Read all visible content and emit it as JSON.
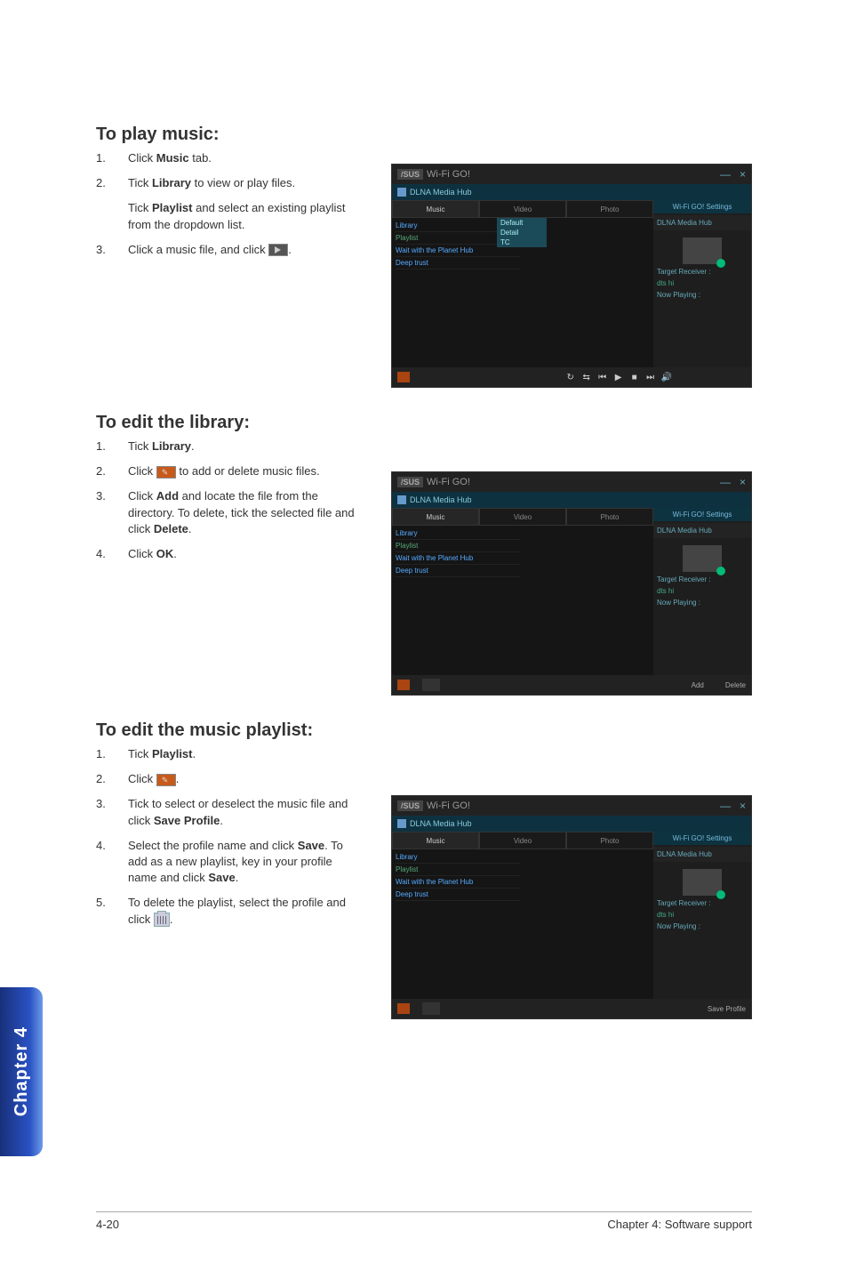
{
  "sections": {
    "playMusic": {
      "heading": "To play music:",
      "steps": [
        {
          "num": "1.",
          "pre": "Click ",
          "bold": "Music",
          "post": " tab."
        },
        {
          "num": "2.",
          "pre": "Tick ",
          "bold": "Library",
          "post": " to view or play files.",
          "sub_pre": "Tick ",
          "sub_bold": "Playlist",
          "sub_post": " and select an existing playlist from the dropdown list."
        },
        {
          "num": "3.",
          "pre": "Click a music file, and click ",
          "icon": "play",
          "post": "."
        }
      ]
    },
    "editLibrary": {
      "heading": "To edit the library:",
      "steps": [
        {
          "num": "1.",
          "pre": "Tick ",
          "bold": "Library",
          "post": "."
        },
        {
          "num": "2.",
          "pre": "Click ",
          "icon": "edit",
          "post": " to add or delete music files."
        },
        {
          "num": "3.",
          "pre": "Click ",
          "bold": "Add",
          "post": " and locate the file from the directory. To delete, tick the selected file and click ",
          "bold2": "Delete",
          "post2": "."
        },
        {
          "num": "4.",
          "pre": "Click ",
          "bold": "OK",
          "post": "."
        }
      ]
    },
    "editPlaylist": {
      "heading": "To edit the music playlist:",
      "steps": [
        {
          "num": "1.",
          "pre": "Tick ",
          "bold": "Playlist",
          "post": "."
        },
        {
          "num": "2.",
          "pre": "Click ",
          "icon": "edit",
          "post": "."
        },
        {
          "num": "3.",
          "pre": "Tick to select or deselect the music file and click ",
          "bold": "Save Profile",
          "post": "."
        },
        {
          "num": "4.",
          "pre": "Select the profile name and click ",
          "bold": "Save",
          "post": ". To add as a new playlist, key in your profile name and click ",
          "bold2": "Save",
          "post2": "."
        },
        {
          "num": "5.",
          "pre": "To delete the playlist, select the profile and click ",
          "icon": "trash",
          "post": "."
        }
      ]
    }
  },
  "screenshots": {
    "title_brand": "/SUS",
    "title_text": "Wi-Fi GO!",
    "win_min": "—",
    "win_close": "×",
    "subband": "DLNA Media Hub",
    "tabs": {
      "music": "Music",
      "video": "Video",
      "photo": "Photo"
    },
    "list_items": [
      "Library",
      "Playlist",
      "Wait with the Planet Hub",
      "Deep trust"
    ],
    "right": {
      "hdr": "Wi-Fi GO! Settings",
      "box": "DLNA Media Hub",
      "target": "Target Receiver :",
      "dts": "dts hi",
      "now": "Now Playing :"
    },
    "dropdown": {
      "default": "Default",
      "detail": "Detail",
      "tc": "TC"
    },
    "bottom": {
      "add": "Add",
      "delete": "Delete",
      "save": "Save Profile"
    }
  },
  "sidebar": "Chapter 4",
  "footer": {
    "left": "4-20",
    "right": "Chapter 4: Software support"
  }
}
